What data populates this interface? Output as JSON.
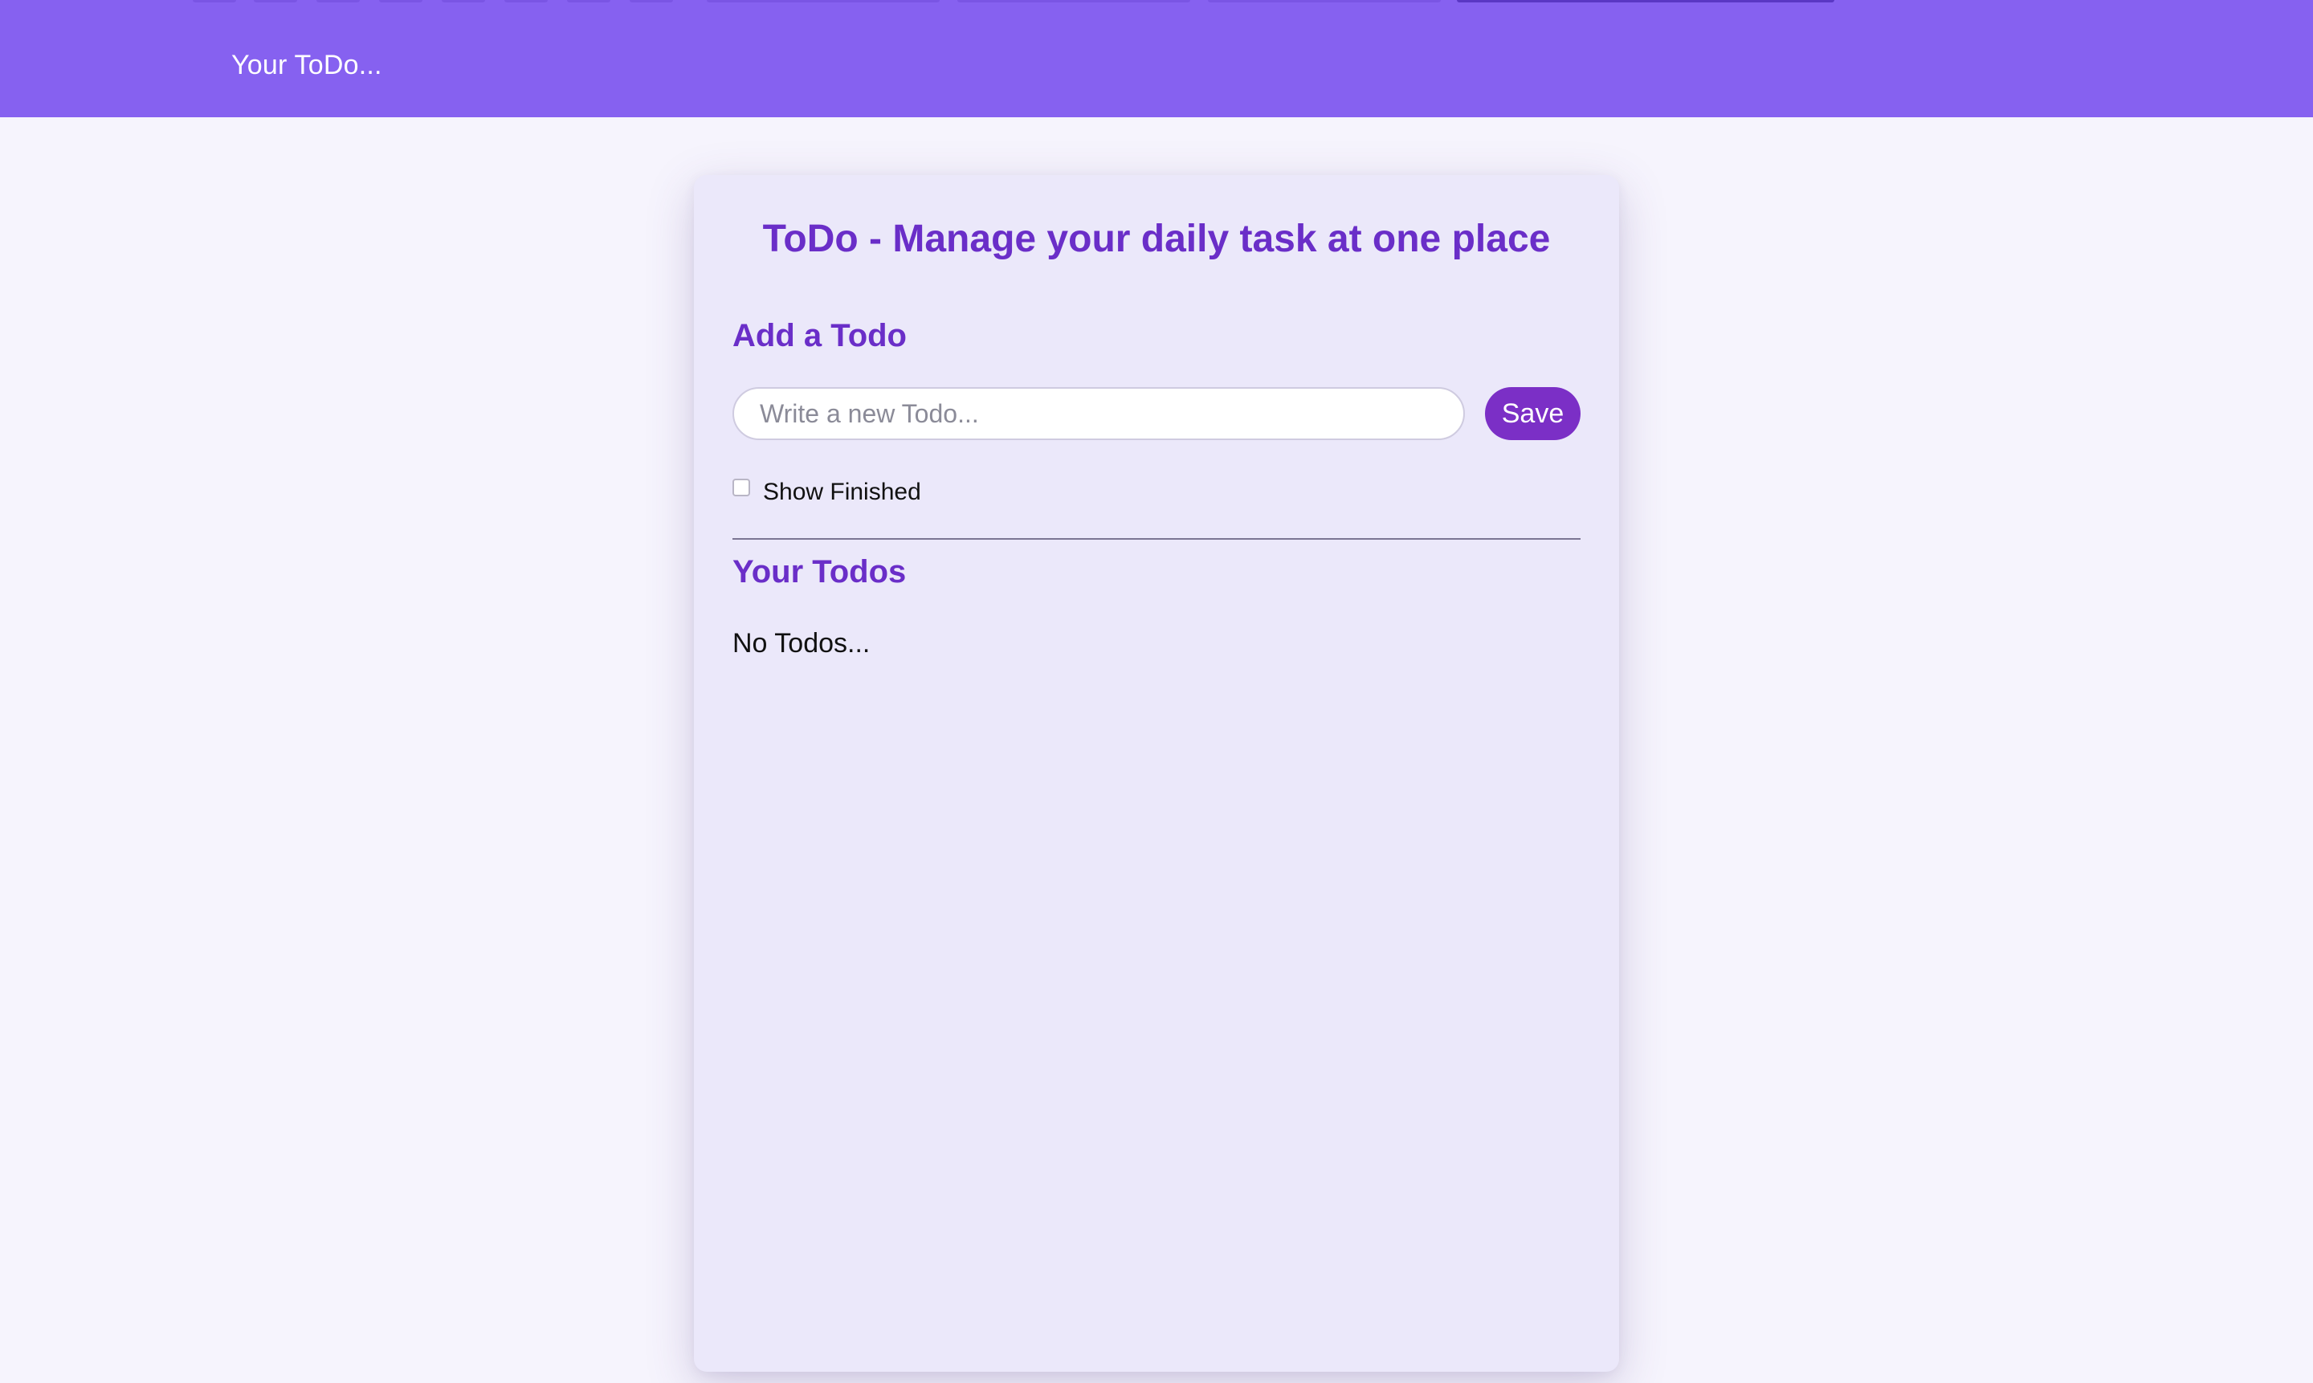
{
  "navbar": {
    "brand": "Your ToDo...",
    "bg_color": "#8661f0"
  },
  "card": {
    "title": "ToDo - Manage your daily task at one place",
    "add_heading": "Add a Todo",
    "input": {
      "placeholder": "Write a new Todo...",
      "value": ""
    },
    "save_label": "Save",
    "show_finished": {
      "label": "Show Finished",
      "checked": false
    },
    "list_heading": "Your Todos",
    "empty_message": "No Todos..."
  },
  "colors": {
    "accent": "#6a2ec8",
    "button": "#7b2fc6",
    "card_bg": "#ebe8fa",
    "page_bg": "#f6f4fd"
  }
}
